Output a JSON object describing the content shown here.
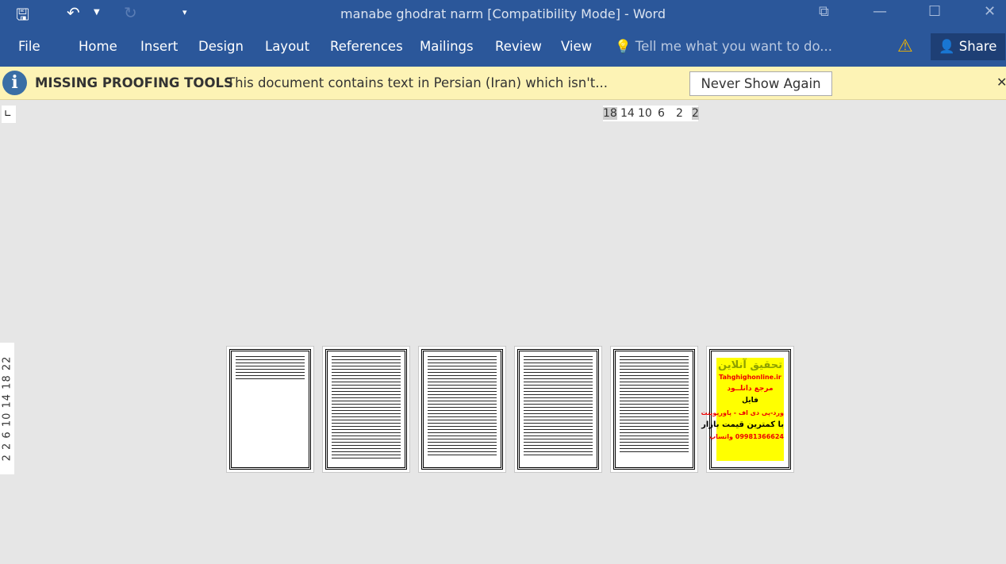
{
  "title": "manabe ghodrat narm [Compatibility Mode] - Word",
  "quick_access": {
    "save": "save-icon",
    "undo": "undo-icon",
    "redo": "redo-icon",
    "customize": "customize-icon"
  },
  "ribbon": {
    "tabs": [
      "File",
      "Home",
      "Insert",
      "Design",
      "Layout",
      "References",
      "Mailings",
      "Review",
      "View"
    ],
    "tell_me": "Tell me what you want to do...",
    "share": "Share"
  },
  "message_bar": {
    "title": "MISSING PROOFING TOOLS",
    "text": "This document contains text in Persian (Iran) which isn't...",
    "button": "Never Show Again"
  },
  "hruler": [
    "18",
    "14",
    "10",
    "6",
    "2",
    "2"
  ],
  "vruler": "2  2  6  10  14  18  22",
  "ad": {
    "line1": "تحقیق آنلاین",
    "line2": "Tahghighonline.ir",
    "line3": "مرجع دانلــود",
    "line4": "فایل",
    "line5": "ورد-پی دی اف - پاورپوینت",
    "line6": "با کمترین قیمت بازار",
    "line7": "09981366624 واتساپ"
  }
}
